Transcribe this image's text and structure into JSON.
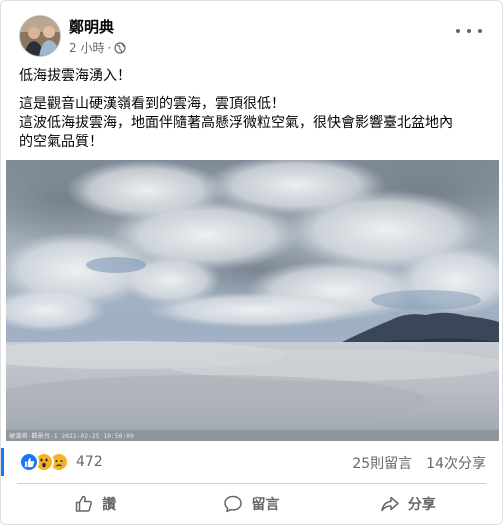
{
  "post": {
    "author": "鄭明典",
    "time": "2 小時",
    "separator": "·",
    "text": {
      "line1": "低海拔雲海湧入！",
      "line2": "這是觀音山硬漢嶺看到的雲海，雲頂很低！",
      "line3": "這波低海拔雲海，地面伴隨著高懸浮微粒空氣，很快會影響臺北盆地內",
      "line4": "的空氣品質！"
    },
    "photo_caption": "硬漢嶺-觀景台-1   2021-02-25  10:50:09",
    "reactions_count": "472",
    "comments": "25則留言",
    "shares": "14次分享",
    "actions": {
      "like": "讚",
      "comment": "留言",
      "share": "分享"
    }
  },
  "colors": {
    "accent": "#1877f2",
    "secondary_text": "#65676b",
    "reaction_yellow": "#f7b125"
  },
  "icons": {
    "privacy": "globe-icon",
    "more": "more-options-icon",
    "like": "thumbs-up-icon",
    "comment": "comment-bubble-icon",
    "share": "share-arrow-icon"
  }
}
